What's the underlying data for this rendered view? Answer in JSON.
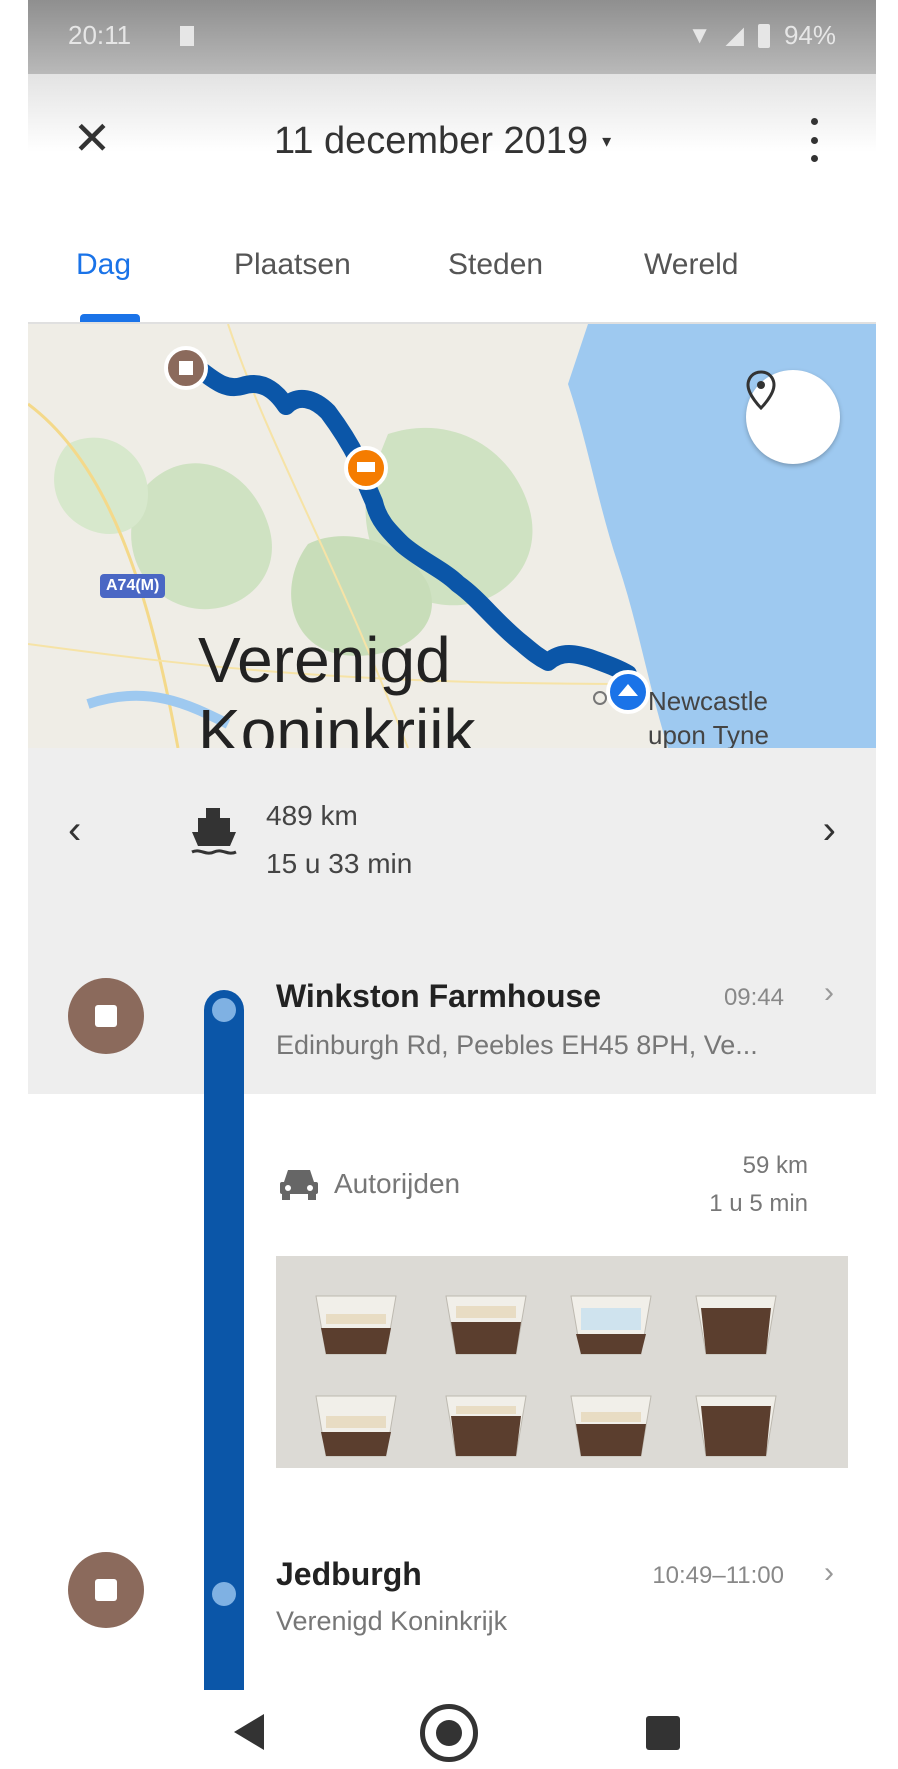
{
  "status_bar": {
    "time": "20:11",
    "battery": "94%"
  },
  "header": {
    "date": "11 december 2019",
    "caret": "▾",
    "close_symbol": "✕"
  },
  "tabs": [
    {
      "label": "Dag",
      "active": true
    },
    {
      "label": "Plaatsen",
      "active": false
    },
    {
      "label": "Steden",
      "active": false
    },
    {
      "label": "Wereld",
      "active": false
    }
  ],
  "map": {
    "country_label_line1": "Verenigd",
    "country_label_line2": "Koninkrijk",
    "city_line1": "Newcastle",
    "city_line2": "upon Tyne",
    "road_badge": "A74(M)",
    "route_color": "#0b56a8",
    "water_color": "#9ec9f0"
  },
  "summary": {
    "prev_symbol": "‹",
    "next_symbol": "›",
    "transport_icon": "ship-icon",
    "distance": "489 km",
    "duration": "15 u 33 min"
  },
  "timeline": {
    "stops": [
      {
        "name": "Winkston Farmhouse",
        "address": "Edinburgh Rd, Peebles EH45 8PH, Ve...",
        "time": "09:44",
        "chevron": "›"
      },
      {
        "name": "Jedburgh",
        "address": "Verenigd Koninkrijk",
        "time": "10:49–11:00",
        "chevron": "›"
      }
    ],
    "activity": {
      "icon": "car-icon",
      "label": "Autorijden",
      "distance": "59 km",
      "duration": "1 u 5 min"
    },
    "stop_color": "#8b6a5c",
    "line_color": "#0b56a8"
  }
}
